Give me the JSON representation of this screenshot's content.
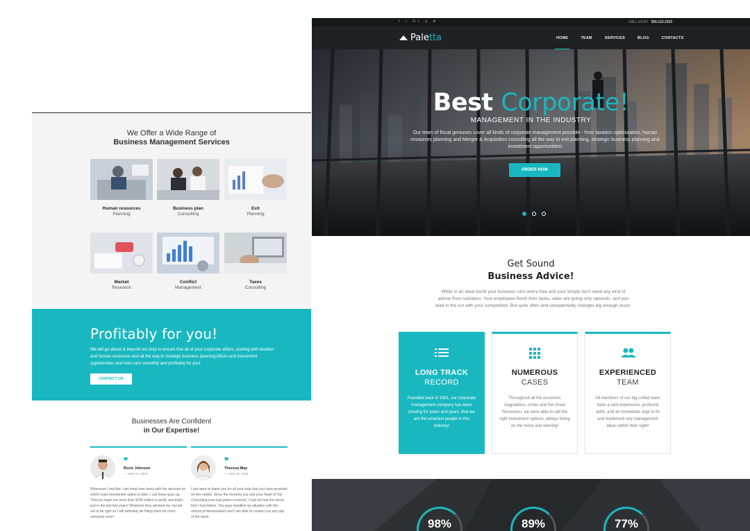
{
  "left": {
    "services_heading": {
      "line1": "We Offer a Wide Range of",
      "line2": "Business Management Services"
    },
    "services": [
      {
        "title": "Human resources",
        "sub": "Planning"
      },
      {
        "title": "Business plan",
        "sub": "Consulting"
      },
      {
        "title": "Exit",
        "sub": "Planning"
      },
      {
        "title": "Market",
        "sub": "Research"
      },
      {
        "title": "Conflict",
        "sub": "Management"
      },
      {
        "title": "Taxes",
        "sub": "Consulting"
      }
    ],
    "profit": {
      "title": "Profitably for you!",
      "text": "We will go above & beyond our duty to ensure that all of your corporate affairs, starting with taxation and human resources and all the way to strategic business planning,M&As and investment opportunities and risks runs smoothly and profitably for you!",
      "button": "CONTACT US"
    },
    "confidence": {
      "line1": "Businesses Are Confident",
      "line2": "in Our Expertise!"
    },
    "testimonials": [
      {
        "name": "Boris Johnson",
        "date": "— June 12, 2016",
        "text": "Whenever I feel like I am head over heels with the decision on which exact investment option to take, I call these guys up. They've made me more than $789 million in profit, and that's just in the last few years! Whatever they advised me, turned out to be right so I will definitely be hiring them for more someone soon!"
      },
      {
        "name": "Theresa May",
        "date": "— June 14, 2016",
        "text": "I just want to thank you for all your help that you have provided on this matter. Since the moment you and your Team of Tax Consulting pros had gotten involved, I had not had the stress that I had before. You guys handled my situation with the utmost professionalism and I am able to contact you any day of the week."
      }
    ]
  },
  "right": {
    "topbar": {
      "social": "f  ✓  G+  ◎  ⊕",
      "call_label": "CALL US AT:",
      "phone": "555.123.2323"
    },
    "logo": {
      "part1": "Pale",
      "part2": "tta"
    },
    "menu": [
      "HOME",
      "TEAM",
      "SERVICES",
      "BLOG",
      "CONTACTS"
    ],
    "hero": {
      "title_bold": "Best",
      "title_accent": "Corporate!",
      "subtitle": "MANAGEMENT IN THE INDUSTRY",
      "description": "Our team of fiscal geniuses cover all kinds of corporate management possible - from taxation optimization, human resources planning and Merger & Acquisition consulting all the way to exit planning, strategic business planning and investment opportunities!",
      "button": "ORDER NOW"
    },
    "advice": {
      "line1": "Get Sound",
      "line2": "Business Advice!",
      "text": "While in an ideal world your business runs worry-free and your simply don't need any kind of advise from outsiders. Your employees finish their tasks, sales are going only upwards, and you lead in the run with your competition. But quite often and unexpectedly changes big enough occur."
    },
    "cards": [
      {
        "icon": "list-icon",
        "t1": "LONG TRACK",
        "t2": "RECORD",
        "text": "Founded back in 1991, our corporate management company has been proving for years and years, that we are the smartest people in this industry!"
      },
      {
        "icon": "grid-icon",
        "t1": "NUMEROUS",
        "t2": "CASES",
        "text": "Throughout all the economic stagnations, crises and the Great Recession, we were able to call the right investment options, always being on the move and winning!"
      },
      {
        "icon": "team-icon",
        "t1": "EXPERIENCED",
        "t2": "TEAM",
        "text": "All members of our big united team have a vast experience, profound skills, and an immediate urge to fix and implement any management ideas within their sight!"
      }
    ],
    "stats": [
      "98%",
      "89%",
      "77%"
    ]
  },
  "colors": {
    "accent": "#19b8c0",
    "dark": "#1f2225"
  }
}
